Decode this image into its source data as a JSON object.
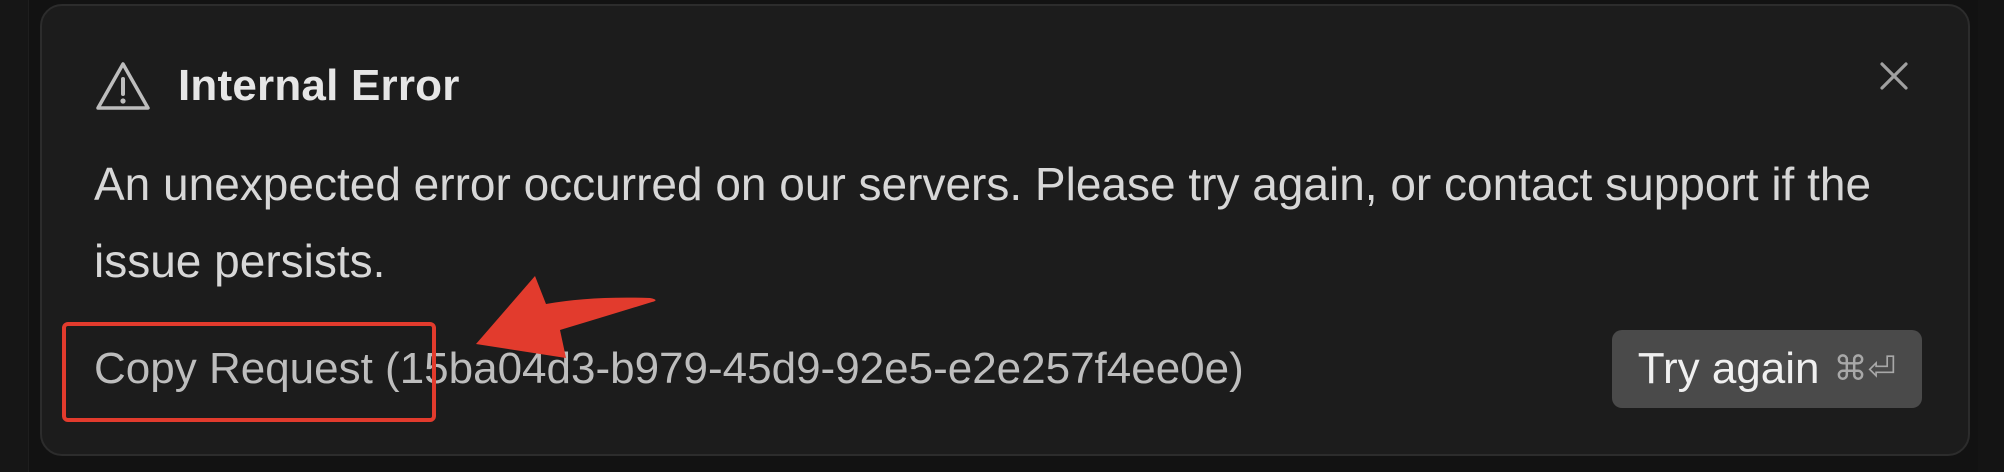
{
  "dialog": {
    "title": "Internal Error",
    "message": "An unexpected error occurred on our servers. Please try again, or contact support if the issue persists.",
    "copy_request_label": "Copy Request (15ba04d3-b979-45d9-92e5-e2e257f4ee0e)",
    "try_again_label": "Try again",
    "try_again_shortcut": "⌘⏎",
    "icons": {
      "title": "warning-triangle-icon",
      "close": "close-icon"
    }
  },
  "annotation": {
    "color": "#e23b2d"
  },
  "colors": {
    "dialog_bg": "#1c1c1c",
    "button_bg": "#4a4a4a",
    "text_primary": "#e6e6e6"
  }
}
